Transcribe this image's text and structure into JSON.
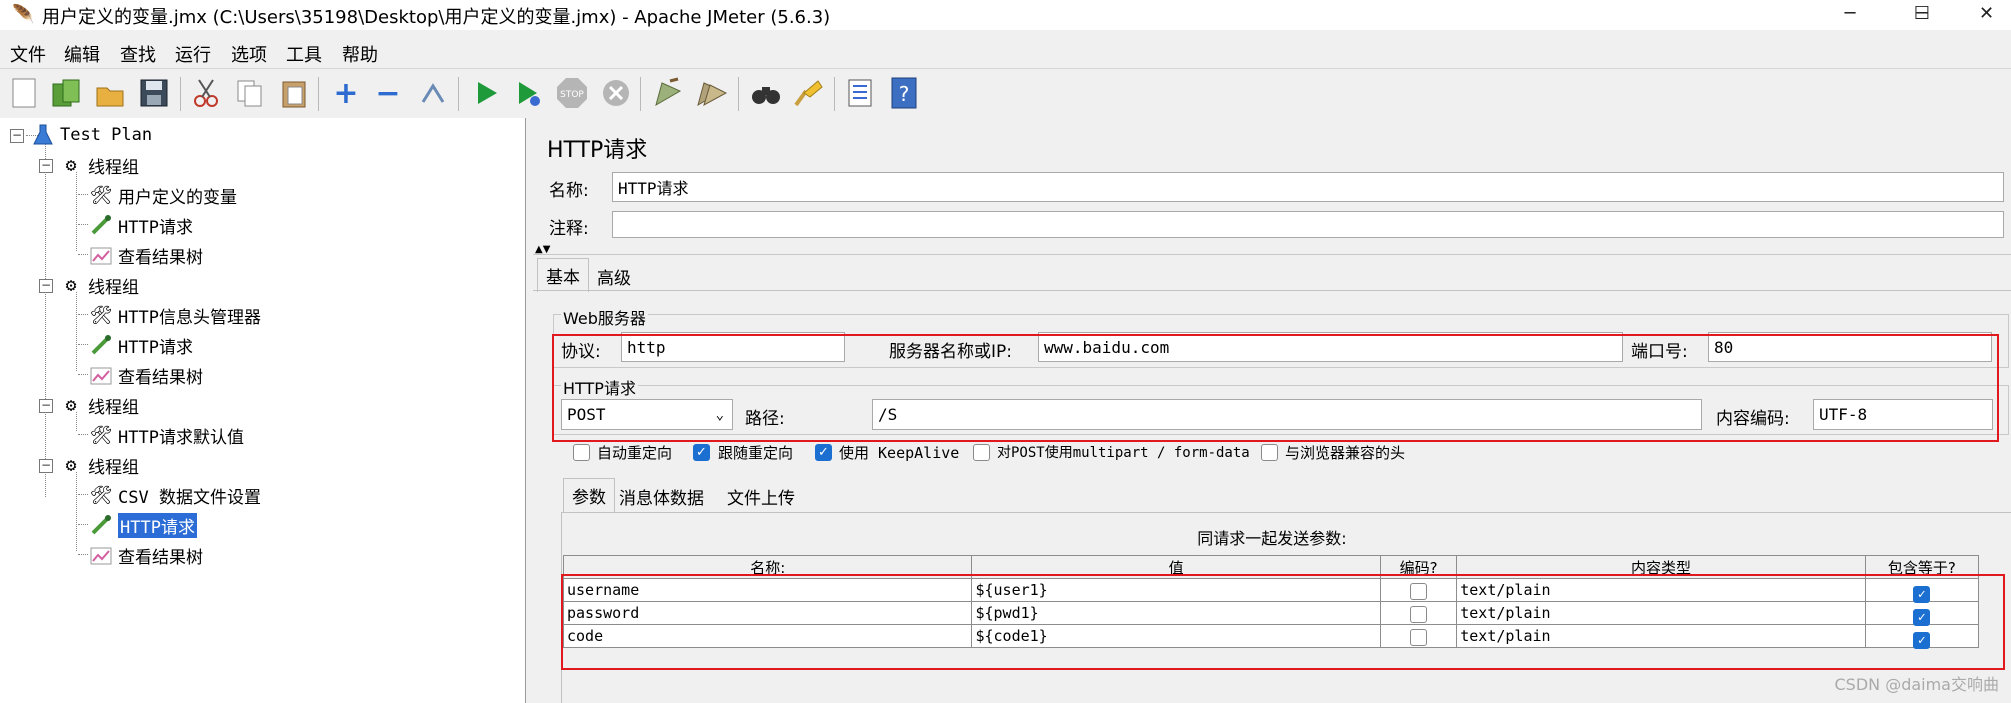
{
  "window": {
    "title": "用户定义的变量.jmx (C:\\Users\\35198\\Desktop\\用户定义的变量.jmx) - Apache JMeter (5.6.3)",
    "minimize": "─",
    "maximize": "☐",
    "close": "✕"
  },
  "menu": [
    "文件",
    "编辑",
    "查找",
    "运行",
    "选项",
    "工具",
    "帮助"
  ],
  "tree": {
    "root": "Test Plan",
    "groups": [
      {
        "label": "线程组",
        "children": [
          "用户定义的变量",
          "HTTP请求",
          "查看结果树"
        ]
      },
      {
        "label": "线程组",
        "children": [
          "HTTP信息头管理器",
          "HTTP请求",
          "查看结果树"
        ]
      },
      {
        "label": "线程组",
        "children": [
          "HTTP请求默认值"
        ]
      },
      {
        "label": "线程组",
        "children": [
          "CSV 数据文件设置",
          "HTTP请求",
          "查看结果树"
        ]
      }
    ]
  },
  "panel": {
    "heading": "HTTP请求",
    "name_label": "名称:",
    "name_value": "HTTP请求",
    "comment_label": "注释:",
    "comment_value": "",
    "tabs": [
      "基本",
      "高级"
    ],
    "web_server": {
      "legend": "Web服务器",
      "protocol_label": "协议:",
      "protocol_value": "http",
      "server_label": "服务器名称或IP:",
      "server_value": "www.baidu.com",
      "port_label": "端口号:",
      "port_value": "80"
    },
    "http_request": {
      "legend": "HTTP请求",
      "method": "POST",
      "path_label": "路径:",
      "path_value": "/S",
      "encoding_label": "内容编码:",
      "encoding_value": "UTF-8"
    },
    "options": [
      {
        "label": "自动重定向",
        "checked": false
      },
      {
        "label": "跟随重定向",
        "checked": true
      },
      {
        "label": "使用 KeepAlive",
        "checked": true
      },
      {
        "label": "对POST使用multipart / form-data",
        "checked": false
      },
      {
        "label": "与浏览器兼容的头",
        "checked": false
      }
    ],
    "subtabs": [
      "参数",
      "消息体数据",
      "文件上传"
    ],
    "params_caption": "同请求一起发送参数:",
    "columns": [
      "名称:",
      "值",
      "编码?",
      "内容类型",
      "包含等于?"
    ],
    "rows": [
      {
        "name": "username",
        "value": "${user1}",
        "encode": false,
        "content_type": "text/plain",
        "include_equals": true
      },
      {
        "name": "password",
        "value": "${pwd1}",
        "encode": false,
        "content_type": "text/plain",
        "include_equals": true
      },
      {
        "name": "code",
        "value": "${code1}",
        "encode": false,
        "content_type": "text/plain",
        "include_equals": true
      }
    ]
  },
  "watermark": "CSDN @daima交响曲"
}
